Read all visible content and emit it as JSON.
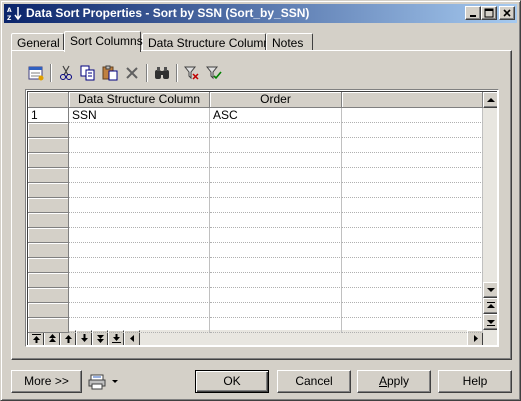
{
  "window": {
    "title": "Data Sort Properties - Sort by SSN (Sort_by_SSN)"
  },
  "tabs": [
    {
      "label": "General"
    },
    {
      "label": "Sort Columns"
    },
    {
      "label": "Data Structure Columns"
    },
    {
      "label": "Notes"
    }
  ],
  "toolbar": {
    "icons": [
      "properties-icon",
      "cut-icon",
      "copy-icon",
      "paste-icon",
      "delete-icon",
      "find-icon",
      "filter-icon",
      "filter-clear-icon"
    ]
  },
  "grid": {
    "columns": [
      "Data Structure Column",
      "Order"
    ],
    "rows": [
      {
        "num": "1",
        "column": "SSN",
        "order": "ASC"
      }
    ]
  },
  "buttons": {
    "more": "More >>",
    "ok": "OK",
    "cancel": "Cancel",
    "apply_pre": "",
    "apply_u": "A",
    "apply_post": "pply",
    "help": "Help"
  },
  "colors": {
    "title_gradient_start": "#0a246a",
    "title_gradient_end": "#a6caf0",
    "face": "#d4d0c8"
  }
}
